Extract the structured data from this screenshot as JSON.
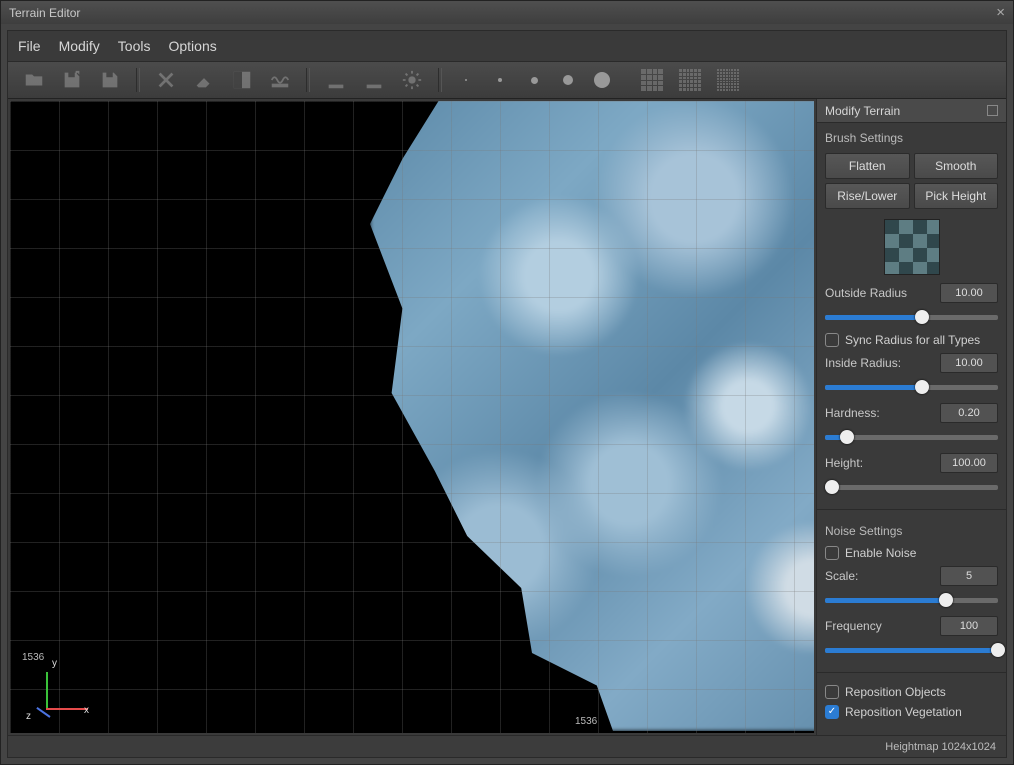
{
  "window": {
    "title": "Terrain Editor"
  },
  "menu": {
    "file": "File",
    "modify": "Modify",
    "tools": "Tools",
    "options": "Options"
  },
  "viewport": {
    "num_left": "1536",
    "num_bottom": "1536",
    "axis_x": "x",
    "axis_y": "y",
    "axis_z": "z"
  },
  "panel": {
    "title": "Modify Terrain",
    "brush_settings": "Brush Settings",
    "flatten": "Flatten",
    "smooth": "Smooth",
    "rise_lower": "Rise/Lower",
    "pick_height": "Pick Height",
    "outside_radius": {
      "label": "Outside Radius",
      "value": "10.00",
      "pct": 56
    },
    "sync_radius": {
      "label": "Sync Radius for all Types",
      "checked": false
    },
    "inside_radius": {
      "label": "Inside Radius:",
      "value": "10.00",
      "pct": 56
    },
    "hardness": {
      "label": "Hardness:",
      "value": "0.20",
      "pct": 13
    },
    "height": {
      "label": "Height:",
      "value": "100.00",
      "pct": 4
    },
    "noise_settings": "Noise Settings",
    "enable_noise": {
      "label": "Enable Noise",
      "checked": false
    },
    "scale": {
      "label": "Scale:",
      "value": "5",
      "pct": 70
    },
    "frequency": {
      "label": "Frequency",
      "value": "100",
      "pct": 100
    },
    "reposition_objects": {
      "label": "Reposition Objects",
      "checked": false
    },
    "reposition_vegetation": {
      "label": "Reposition Vegetation",
      "checked": true
    }
  },
  "status": {
    "heightmap": "Heightmap 1024x1024"
  }
}
